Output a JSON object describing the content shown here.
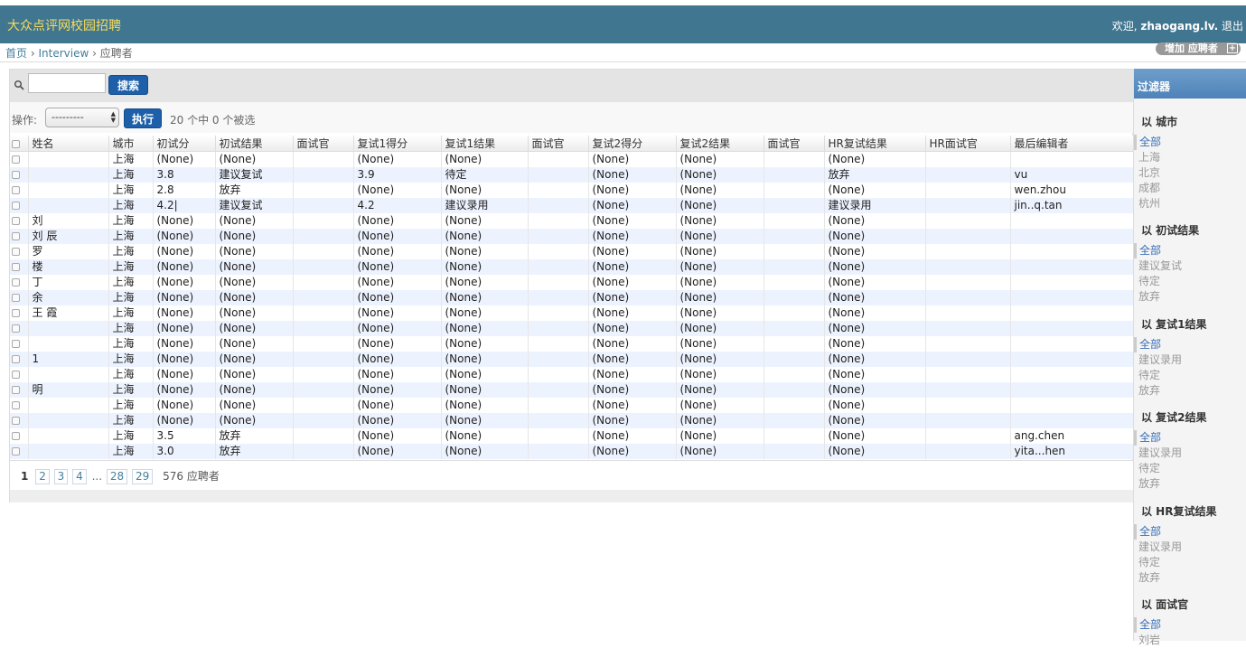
{
  "header": {
    "brand": "大众点评网校园招聘",
    "welcome": "欢迎,",
    "username": "zhaogang.lv.",
    "logout": "退出"
  },
  "breadcrumbs": {
    "home": "首页",
    "sep": "›",
    "app": "Interview",
    "current": "应聘者"
  },
  "add_button": {
    "label": "增加 应聘者",
    "icon": "plus-icon"
  },
  "search": {
    "value": "",
    "button": "搜索"
  },
  "actions": {
    "label": "操作:",
    "select_value": "---------",
    "go_button": "执行",
    "counter": "20 个中 0 个被选"
  },
  "table": {
    "columns": [
      "姓名",
      "城市",
      "初试分",
      "初试结果",
      "面试官",
      "复试1得分",
      "复试1结果",
      "面试官",
      "复试2得分",
      "复试2结果",
      "面试官",
      "HR复试结果",
      "HR面试官",
      "最后编辑者"
    ],
    "rows": [
      [
        "",
        "上海",
        "(None)",
        "(None)",
        "",
        "(None)",
        "(None)",
        "",
        "(None)",
        "(None)",
        "",
        "(None)",
        "",
        ""
      ],
      [
        "",
        "上海",
        "3.8",
        "建议复试",
        "",
        "3.9",
        "待定",
        "",
        "(None)",
        "(None)",
        "",
        "放弃",
        "",
        "vu"
      ],
      [
        "",
        "上海",
        "2.8",
        "放弃",
        "",
        "(None)",
        "(None)",
        "",
        "(None)",
        "(None)",
        "",
        "(None)",
        "",
        "wen.zhou"
      ],
      [
        "",
        "上海",
        "4.2|",
        "建议复试",
        "",
        "4.2",
        "建议录用",
        "",
        "(None)",
        "(None)",
        "",
        "建议录用",
        "",
        "jin..q.tan"
      ],
      [
        "刘",
        "上海",
        "(None)",
        "(None)",
        "",
        "(None)",
        "(None)",
        "",
        "(None)",
        "(None)",
        "",
        "(None)",
        "",
        ""
      ],
      [
        "刘 辰",
        "上海",
        "(None)",
        "(None)",
        "",
        "(None)",
        "(None)",
        "",
        "(None)",
        "(None)",
        "",
        "(None)",
        "",
        ""
      ],
      [
        "罗",
        "上海",
        "(None)",
        "(None)",
        "",
        "(None)",
        "(None)",
        "",
        "(None)",
        "(None)",
        "",
        "(None)",
        "",
        ""
      ],
      [
        "楼",
        "上海",
        "(None)",
        "(None)",
        "",
        "(None)",
        "(None)",
        "",
        "(None)",
        "(None)",
        "",
        "(None)",
        "",
        ""
      ],
      [
        "丁",
        "上海",
        "(None)",
        "(None)",
        "",
        "(None)",
        "(None)",
        "",
        "(None)",
        "(None)",
        "",
        "(None)",
        "",
        ""
      ],
      [
        "余",
        "上海",
        "(None)",
        "(None)",
        "",
        "(None)",
        "(None)",
        "",
        "(None)",
        "(None)",
        "",
        "(None)",
        "",
        ""
      ],
      [
        "王 霞",
        "上海",
        "(None)",
        "(None)",
        "",
        "(None)",
        "(None)",
        "",
        "(None)",
        "(None)",
        "",
        "(None)",
        "",
        ""
      ],
      [
        "",
        "上海",
        "(None)",
        "(None)",
        "",
        "(None)",
        "(None)",
        "",
        "(None)",
        "(None)",
        "",
        "(None)",
        "",
        ""
      ],
      [
        "",
        "上海",
        "(None)",
        "(None)",
        "",
        "(None)",
        "(None)",
        "",
        "(None)",
        "(None)",
        "",
        "(None)",
        "",
        ""
      ],
      [
        "1",
        "上海",
        "(None)",
        "(None)",
        "",
        "(None)",
        "(None)",
        "",
        "(None)",
        "(None)",
        "",
        "(None)",
        "",
        ""
      ],
      [
        "",
        "上海",
        "(None)",
        "(None)",
        "",
        "(None)",
        "(None)",
        "",
        "(None)",
        "(None)",
        "",
        "(None)",
        "",
        ""
      ],
      [
        "明",
        "上海",
        "(None)",
        "(None)",
        "",
        "(None)",
        "(None)",
        "",
        "(None)",
        "(None)",
        "",
        "(None)",
        "",
        ""
      ],
      [
        "",
        "上海",
        "(None)",
        "(None)",
        "",
        "(None)",
        "(None)",
        "",
        "(None)",
        "(None)",
        "",
        "(None)",
        "",
        ""
      ],
      [
        "",
        "上海",
        "(None)",
        "(None)",
        "",
        "(None)",
        "(None)",
        "",
        "(None)",
        "(None)",
        "",
        "(None)",
        "",
        ""
      ],
      [
        "",
        "上海",
        "3.5",
        "放弃",
        "",
        "(None)",
        "(None)",
        "",
        "(None)",
        "(None)",
        "",
        "(None)",
        "",
        "ang.chen"
      ],
      [
        "",
        "上海",
        "3.0",
        "放弃",
        "",
        "(None)",
        "(None)",
        "",
        "(None)",
        "(None)",
        "",
        "(None)",
        "",
        "yita...hen"
      ]
    ]
  },
  "pagination": {
    "current": "1",
    "pages": [
      "2",
      "3",
      "4"
    ],
    "dots": "...",
    "tail": [
      "28",
      "29"
    ],
    "total": "576 应聘者"
  },
  "filter": {
    "title": "过滤器",
    "groups": [
      {
        "title": "以 城市",
        "options": [
          "全部",
          "上海",
          "北京",
          "成都",
          "杭州"
        ]
      },
      {
        "title": "以 初试结果",
        "options": [
          "全部",
          "建议复试",
          "待定",
          "放弃"
        ]
      },
      {
        "title": "以 复试1结果",
        "options": [
          "全部",
          "建议录用",
          "待定",
          "放弃"
        ]
      },
      {
        "title": "以 复试2结果",
        "options": [
          "全部",
          "建议录用",
          "待定",
          "放弃"
        ]
      },
      {
        "title": "以 HR复试结果",
        "options": [
          "全部",
          "建议录用",
          "待定",
          "放弃"
        ]
      },
      {
        "title": "以 面试官",
        "options": [
          "全部",
          "刘岩"
        ]
      }
    ]
  }
}
